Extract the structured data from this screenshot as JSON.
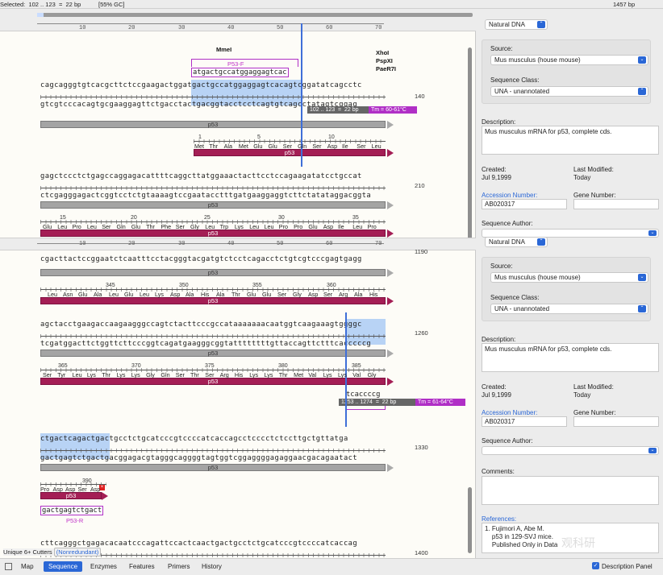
{
  "status": {
    "selected": "Selected:  102 .. 123  =  22 bp",
    "gc": "[55% GC]",
    "length": "1457 bp",
    "zoom": "(0%)"
  },
  "ruler": {
    "ticks": [
      "10",
      "20",
      "30",
      "40",
      "50",
      "60",
      "70"
    ]
  },
  "block1": {
    "enzymes": [
      "MmeI",
      "XhoI",
      "PspXI",
      "PaeR7I"
    ],
    "primer_top": {
      "label": "P53-F",
      "seq": "atgactgccatggaggagtcac"
    },
    "top": "cagcagggtgtcacgcttctccgaagactggatgactgccatggaggagtcacagtcggatatcagcctc",
    "bottom": "gtcgtcccacagtgcgaaggagttctgacctactgacggtacctcctcagtgtcagcctatagtcggag",
    "linenum": "140",
    "sel": "102 .. 123  =  22 bp",
    "tm": "Tm = 60-61°C",
    "bar_label": "p53",
    "aa_nums": [
      "1",
      "5",
      "10"
    ],
    "aa": [
      "Met",
      "Thr",
      "Ala",
      "Met",
      "Glu",
      "Glu",
      "Ser",
      "Gln",
      "Ser",
      "Asp",
      "Ile",
      "Ser",
      "Leu"
    ],
    "aa_bar": "p53"
  },
  "block2": {
    "top": "gagctccctctgagccaggagacattttcaggcttatggaaactacttcctccagaagatatcctgccat",
    "bottom": "ctcgagggagactcggtcctctgtaaaagtccgaatacctttgatgaaggaggtcttctatataggacggta",
    "linenum": "210",
    "bar_label": "p53",
    "aa_nums": [
      "15",
      "20",
      "25",
      "30",
      "35"
    ],
    "aa": [
      "Glu",
      "Leu",
      "Pro",
      "Leu",
      "Ser",
      "Gln",
      "Glu",
      "Thr",
      "Phe",
      "Ser",
      "Gly",
      "Leu",
      "Trp",
      "Lys",
      "Leu",
      "Leu",
      "Pro",
      "Pro",
      "Glu",
      "Asp",
      "Ile",
      "Leu",
      "Pro"
    ],
    "aa_bar": "p53"
  },
  "block3": {
    "top": "cgacttactccggaatctcaatttcctacgggtacgatgtctcctcagacctctgtcgtcccgagtgagg",
    "linenum": "1190",
    "bar_label": "p53",
    "aa_nums": [
      "345",
      "350",
      "355",
      "360"
    ],
    "aa": [
      "Leu",
      "Asn",
      "Glu",
      "Ala",
      "Leu",
      "Glu",
      "Leu",
      "Lys",
      "Asp",
      "Ala",
      "His",
      "Ala",
      "Thr",
      "Glu",
      "Glu",
      "Ser",
      "Gly",
      "Asp",
      "Ser",
      "Arg",
      "Ala",
      "His"
    ],
    "aa_bar": "p53"
  },
  "block4": {
    "top": "agctacctgaagaccaagaagggccagtctacttcccgccataaaaaaacaatggtcaagaaagtggggc",
    "bottom": "tcgatggacttctggttcttcccggtcagatgaagggcggtattttttttgttaccagttctttcacccccg",
    "linenum": "1260",
    "bar_label": "p53",
    "aa_nums": [
      "365",
      "370",
      "375",
      "380",
      "385"
    ],
    "aa": [
      "Ser",
      "Tyr",
      "Leu",
      "Lys",
      "Thr",
      "Lys",
      "Lys",
      "Gly",
      "Gln",
      "Ser",
      "Thr",
      "Ser",
      "Arg",
      "His",
      "Lys",
      "Lys",
      "Thr",
      "Met",
      "Val",
      "Lys",
      "Lys",
      "Val",
      "Gly"
    ],
    "aa_bar": "p53",
    "primer_rev": "tcaccccg",
    "sel": "1253 .. 1274  =  22 bp",
    "tm": "Tm = 61-64°C"
  },
  "block5": {
    "top": "ctgactcagactgactgcctctgcatcccgtccccatcaccagcctcccctctccttgctgttatga",
    "bottom": "gactgagtctgactgacggagacgtagggcaggggtagtggtcggaggggagaggaacgacagaatact",
    "linenum": "1330",
    "bar_label": "p53",
    "aa_num": "390",
    "aa": [
      "Pro",
      "Asp",
      "Asp",
      "Ser",
      "Asp"
    ],
    "aa_bar": "p53",
    "primer_rev": {
      "label": "P53-R",
      "seq": "gactgagtctgact"
    }
  },
  "block6": {
    "top": "cttcagggctgagacacaatcccagattccactcaactgactgcctctgcatcccgtccccatcaccag",
    "bottom": "gaagtcccgactctgtgttagggtctaaggtgagttgactgacggagacgtagggcaggggtagtggtc",
    "linenum": "1400"
  },
  "right": {
    "mol_type": "Natural DNA",
    "source_label": "Source:",
    "source": "Mus musculus (house mouse)",
    "class_label": "Sequence Class:",
    "seq_class": "UNA - unannotated",
    "desc_label": "Description:",
    "description": "Mus musculus mRNA for p53, complete cds.",
    "created_label": "Created:",
    "created": "Jul 9,1999",
    "modified_label": "Last Modified:",
    "modified": "Today",
    "accession_label": "Accession Number:",
    "accession": "AB020317",
    "gene_label": "Gene Number:",
    "author_label": "Sequence Author:",
    "comments_label": "Comments:",
    "references_label": "References:",
    "references": "1. Fujimori A, Abe M.\n    p53 in 129-SVJ mice.\n    Published Only in Data"
  },
  "bottom": {
    "cutters": "Unique 6+ Cutters",
    "nonredundant": "(Nonredundant)",
    "tabs": [
      "Map",
      "Sequence",
      "Enzymes",
      "Features",
      "Primers",
      "History"
    ],
    "desc_panel": "Description Panel"
  },
  "watermark": "观科研"
}
